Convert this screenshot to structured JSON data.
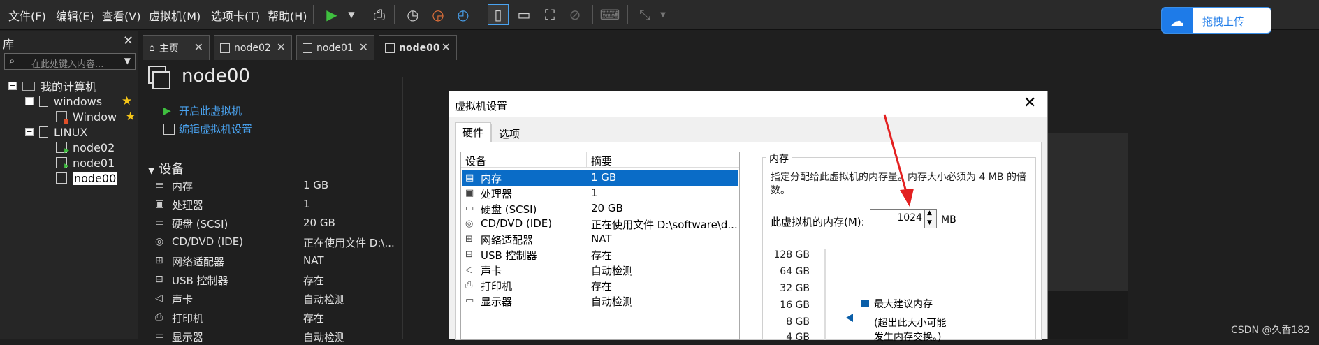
{
  "menubar": {
    "items": [
      "文件(F)",
      "编辑(E)",
      "查看(V)",
      "虚拟机(M)",
      "选项卡(T)",
      "帮助(H)"
    ]
  },
  "upload": {
    "label": "拖拽上传",
    "icon": "cloud-icon"
  },
  "library": {
    "title": "库",
    "search_placeholder": "在此处键入内容...",
    "tree": [
      {
        "label": "我的计算机",
        "type": "pc"
      },
      {
        "label": "windows",
        "type": "folder"
      },
      {
        "label": "Window",
        "type": "vm"
      },
      {
        "label": "LINUX",
        "type": "folder"
      },
      {
        "label": "node02",
        "type": "vm"
      },
      {
        "label": "node01",
        "type": "vm"
      },
      {
        "label": "node00",
        "type": "vm"
      }
    ]
  },
  "tabs": [
    {
      "label": "主页"
    },
    {
      "label": "node02"
    },
    {
      "label": "node01"
    },
    {
      "label": "node00"
    }
  ],
  "vm": {
    "title": "node00",
    "actions": [
      "开启此虚拟机",
      "编辑虚拟机设置"
    ],
    "devices_title": "设备",
    "devices": [
      {
        "name": "内存",
        "value": "1 GB"
      },
      {
        "name": "处理器",
        "value": "1"
      },
      {
        "name": "硬盘 (SCSI)",
        "value": "20 GB"
      },
      {
        "name": "CD/DVD (IDE)",
        "value": "正在使用文件 D:\\..."
      },
      {
        "name": "网络适配器",
        "value": "NAT"
      },
      {
        "name": "USB 控制器",
        "value": "存在"
      },
      {
        "name": "声卡",
        "value": "自动检测"
      },
      {
        "name": "打印机",
        "value": "存在"
      },
      {
        "name": "显示器",
        "value": "自动检测"
      }
    ]
  },
  "dialog": {
    "title": "虚拟机设置",
    "tabs": [
      "硬件",
      "选项"
    ],
    "list_headers": [
      "设备",
      "摘要"
    ],
    "list": [
      {
        "name": "内存",
        "value": "1 GB"
      },
      {
        "name": "处理器",
        "value": "1"
      },
      {
        "name": "硬盘 (SCSI)",
        "value": "20 GB"
      },
      {
        "name": "CD/DVD (IDE)",
        "value": "正在使用文件 D:\\software\\d..."
      },
      {
        "name": "网络适配器",
        "value": "NAT"
      },
      {
        "name": "USB 控制器",
        "value": "存在"
      },
      {
        "name": "声卡",
        "value": "自动检测"
      },
      {
        "name": "打印机",
        "value": "存在"
      },
      {
        "name": "显示器",
        "value": "自动检测"
      }
    ],
    "memory": {
      "legend": "内存",
      "description": "指定分配给此虚拟机的内存量。内存大小必须为 4 MB 的倍数。",
      "label": "此虚拟机的内存(M):",
      "value": "1024",
      "unit": "MB",
      "scale": [
        "128 GB",
        "64 GB",
        "32 GB",
        "16 GB",
        "8 GB",
        "4 GB"
      ],
      "recommended_label": "最大建议内存",
      "recommended_note_1": "(超出此大小可能",
      "recommended_note_2": "发生内存交换。)"
    }
  },
  "watermark": "CSDN @久香182",
  "colors": {
    "accent": "#0a6cc7",
    "link": "#4aa3f0",
    "play": "#3fbf3f",
    "arrow": "#e32020"
  }
}
